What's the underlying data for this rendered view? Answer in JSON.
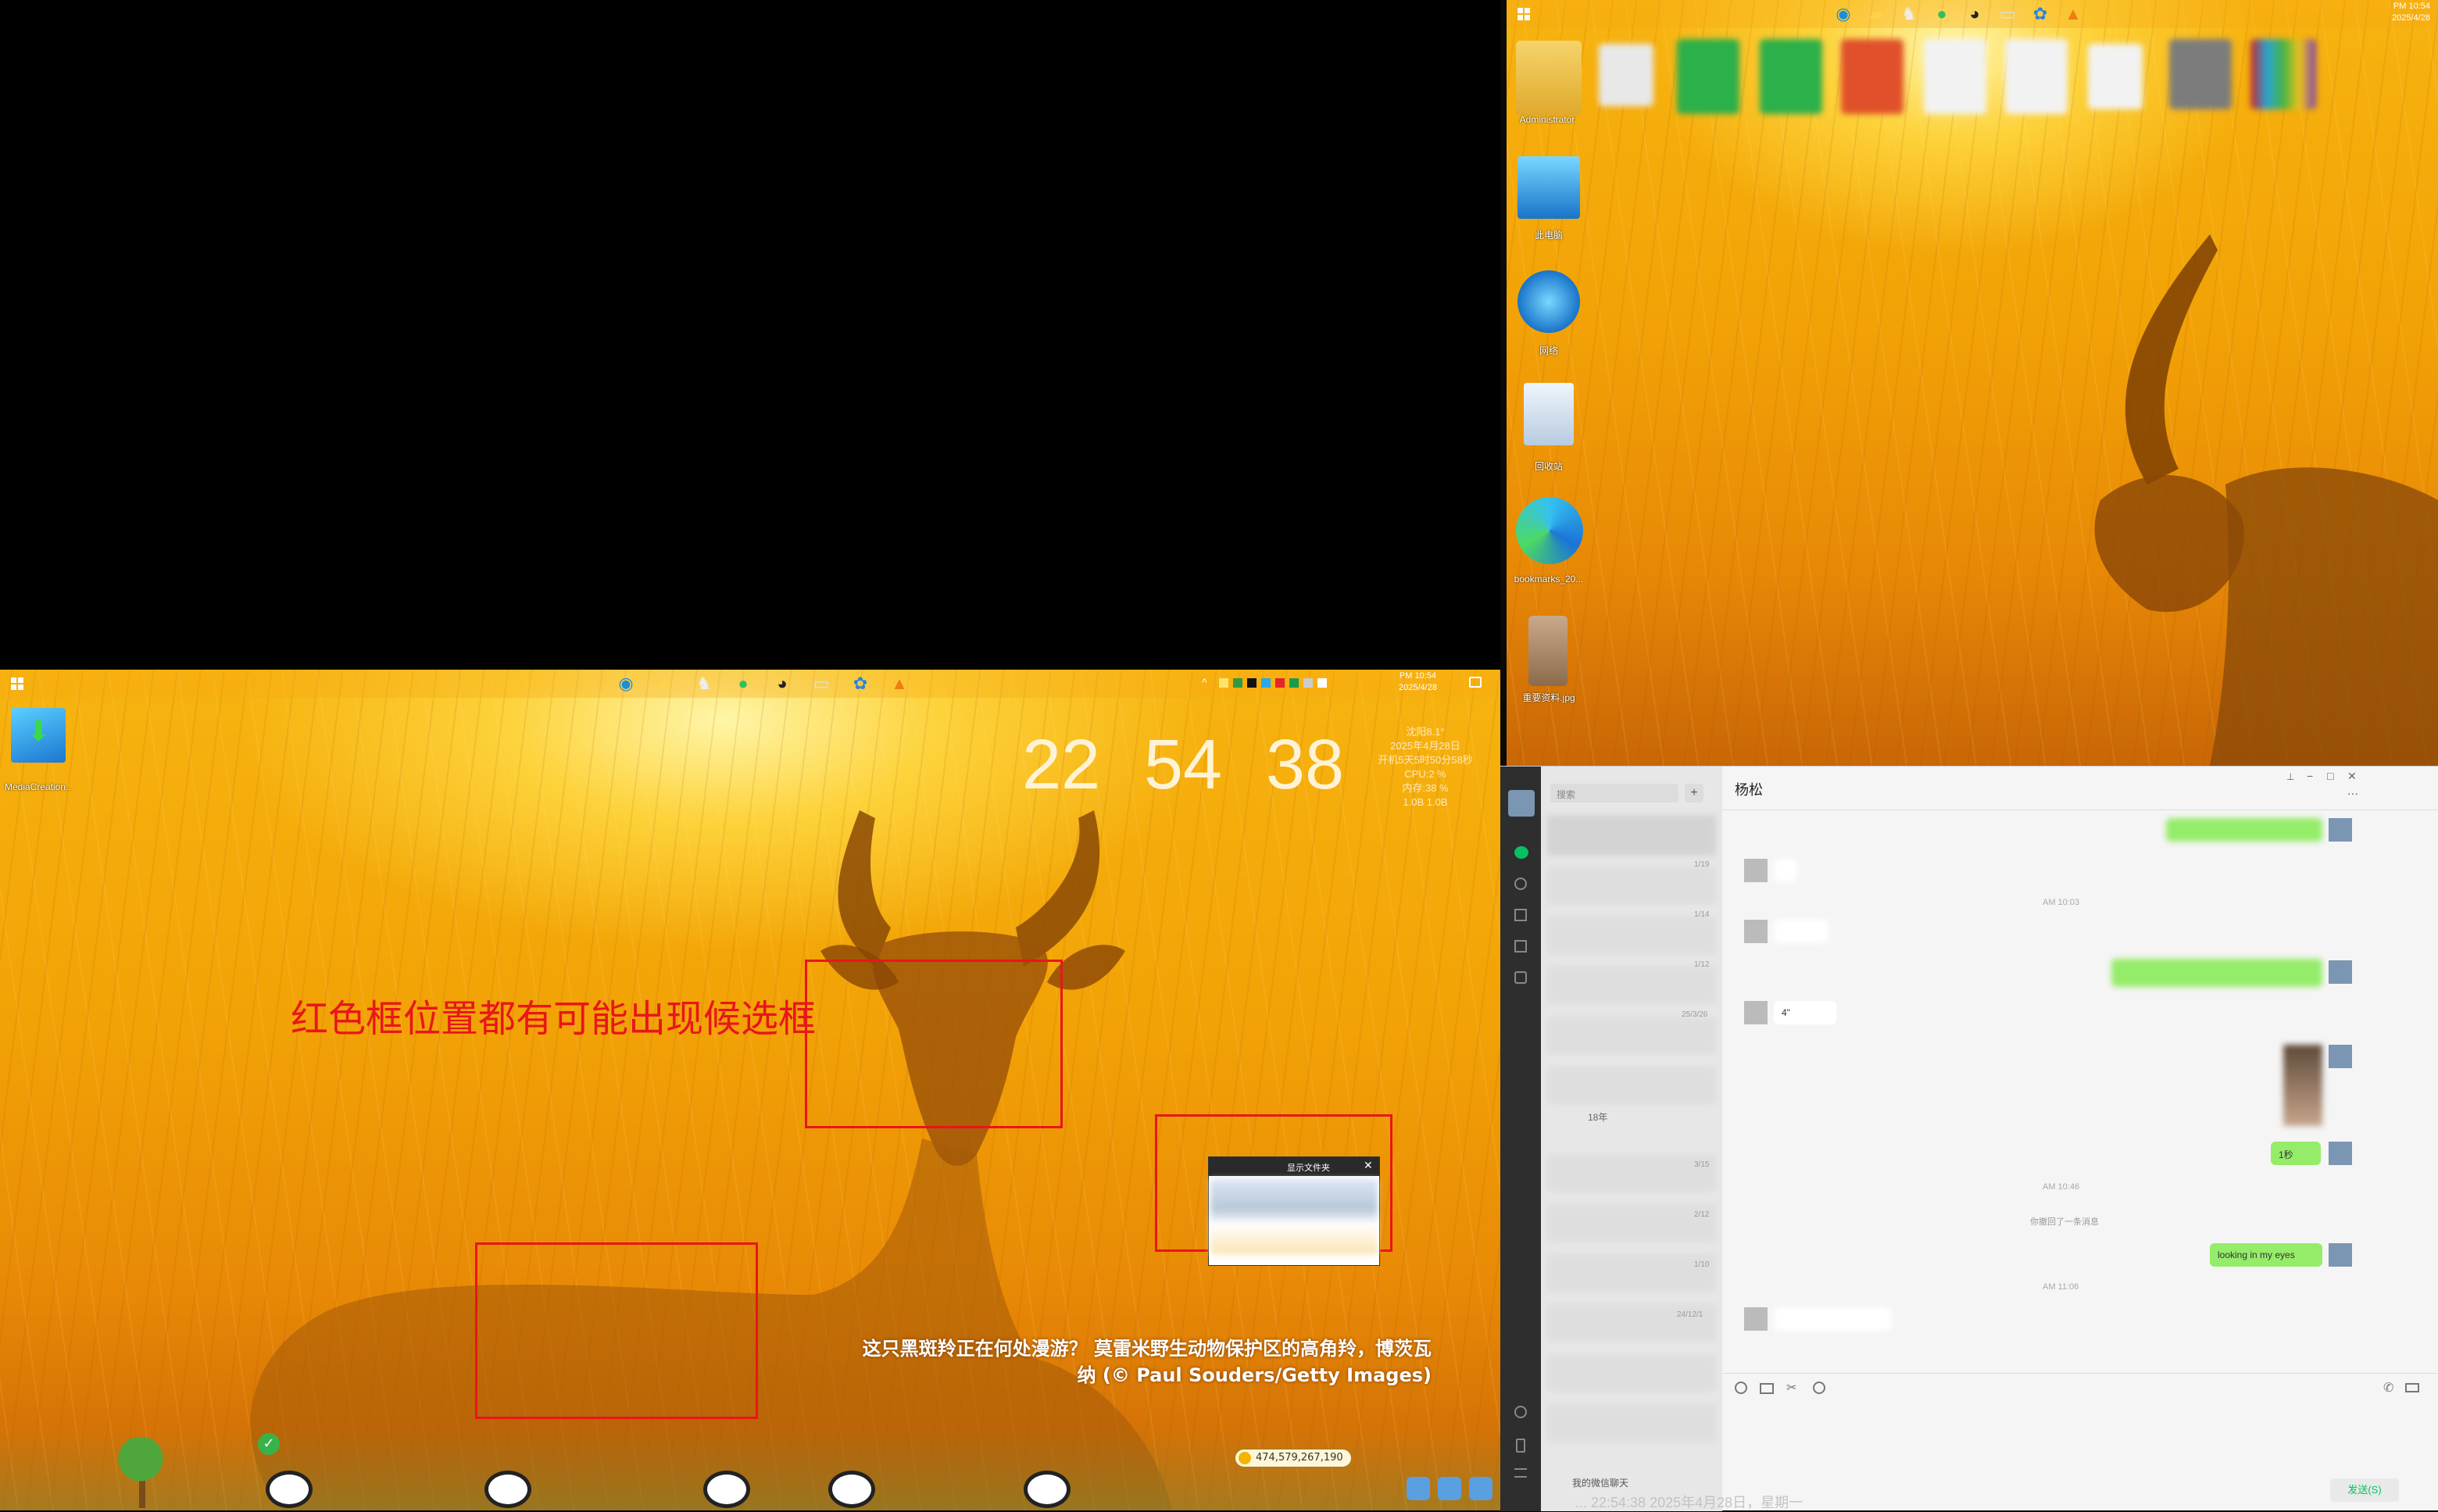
{
  "left_screen": {
    "taskbar": {
      "date_line1": "PM 10:54",
      "date_line2": "2025/4/28",
      "tray_expand": "^"
    },
    "desktop_icon_label": "MediaCreation...",
    "clock": {
      "hours": "22",
      "minutes": "54",
      "seconds": "38"
    },
    "sysinfo": {
      "weather": "沈阳8.1°",
      "date": "2025年4月28日",
      "uptime": "开机5天5时50分58秒",
      "cpu": "CPU:2 %",
      "memory": "内存:38 %",
      "net": "1.0B 1.0B"
    },
    "annotation": "红色框位置都有可能出现候选框",
    "caption_line1": "这只黑斑羚正在何处漫游？ 莫雷米野生动物保护区的高角羚，博茨瓦",
    "caption_line2": "纳 (© Paul Souders/Getty Images)",
    "popup_close": "✕",
    "popup_title": "显示文件夹",
    "coin_counter": "474,579,267,190",
    "colors": {
      "annotation": "#e8161a",
      "redbox": "#e8161a"
    }
  },
  "right_screen": {
    "taskbar": {
      "time": "PM 10:54",
      "date": "2025/4/28"
    },
    "desktop_icons": [
      "Administrator",
      "此电脑",
      "网络",
      "回收站",
      "bookmarks_20...",
      "重要资料.jpg"
    ]
  },
  "wechat": {
    "search_placeholder": "搜索",
    "add_button": "+",
    "chat_title": "杨松",
    "window_controls": {
      "pin": "⊥",
      "minimize": "−",
      "maximize": "□",
      "close": "✕",
      "more": "···"
    },
    "timestamps": [
      "AM 10:03",
      "AM 10:46",
      "AM 11:06"
    ],
    "system_message": "你撤回了一条消息",
    "voice_duration": "4\"",
    "reply_text_1": "1秒",
    "reply_text_2": "looking in my eyes",
    "send_button": "发送(S)",
    "footer_text": "我的微信聊天",
    "status_text": "... 22:54:38 2025年4月28日，星期一",
    "list_dates": [
      "1/19",
      "1/14",
      "1/12",
      "25/3/26",
      "3/15",
      "2/12",
      "1/10",
      "24/12/1"
    ],
    "list_names": [
      "18年"
    ]
  }
}
